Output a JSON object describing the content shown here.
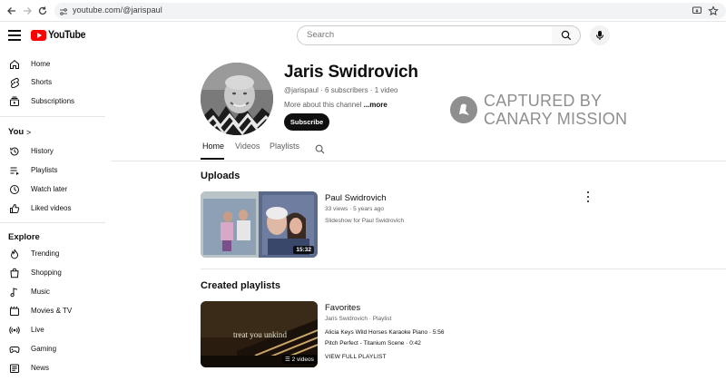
{
  "browser": {
    "url": "youtube.com/@jarispaul"
  },
  "masthead": {
    "logo_text": "YouTube",
    "search_placeholder": "Search"
  },
  "sidebar": {
    "main": [
      {
        "label": "Home",
        "icon": "home-icon"
      },
      {
        "label": "Shorts",
        "icon": "shorts-icon"
      },
      {
        "label": "Subscriptions",
        "icon": "subscriptions-icon"
      }
    ],
    "you_heading": "You",
    "you_chevron": ">",
    "you": [
      {
        "label": "History",
        "icon": "history-icon"
      },
      {
        "label": "Playlists",
        "icon": "playlists-icon"
      },
      {
        "label": "Watch later",
        "icon": "watch-later-icon"
      },
      {
        "label": "Liked videos",
        "icon": "liked-videos-icon"
      }
    ],
    "explore_heading": "Explore",
    "explore": [
      {
        "label": "Trending",
        "icon": "trending-icon"
      },
      {
        "label": "Shopping",
        "icon": "shopping-icon"
      },
      {
        "label": "Music",
        "icon": "music-icon"
      },
      {
        "label": "Movies & TV",
        "icon": "movies-icon"
      },
      {
        "label": "Live",
        "icon": "live-icon"
      },
      {
        "label": "Gaming",
        "icon": "gaming-icon"
      },
      {
        "label": "News",
        "icon": "news-icon"
      }
    ]
  },
  "channel": {
    "name": "Jaris Swidrovich",
    "meta": "@jarispaul · 6 subscribers · 1 video",
    "about": "More about this channel ",
    "about_more": "...more",
    "subscribe_label": "Subscribe"
  },
  "watermark": {
    "line1": "CAPTURED BY",
    "line2": "CANARY MISSION"
  },
  "tabs": [
    {
      "label": "Home",
      "active": true
    },
    {
      "label": "Videos",
      "active": false
    },
    {
      "label": "Playlists",
      "active": false
    }
  ],
  "uploads": {
    "heading": "Uploads",
    "video": {
      "title": "Paul Swidrovich",
      "meta": "33 views · 5 years ago",
      "description": "Slideshow for Paul Swidrovich",
      "duration": "15:32"
    }
  },
  "playlists": {
    "heading": "Created playlists",
    "playlist": {
      "title": "Favorites",
      "meta": "Jaris Swidrovich · Playlist",
      "thumb_caption": "treat you unkind",
      "video_count": "2 videos",
      "items": [
        {
          "title": "Alicia Keys Wild Horses Karaoke Piano",
          "duration": "5:56"
        },
        {
          "title": "Pitch Perfect - Titanium Scene",
          "duration": "0:42"
        }
      ],
      "view_full": "VIEW FULL PLAYLIST"
    }
  },
  "colors": {
    "brand_red": "#ff0000",
    "text_primary": "#0f0f0f",
    "text_secondary": "#606060",
    "watermark": "#8f8f8f"
  }
}
